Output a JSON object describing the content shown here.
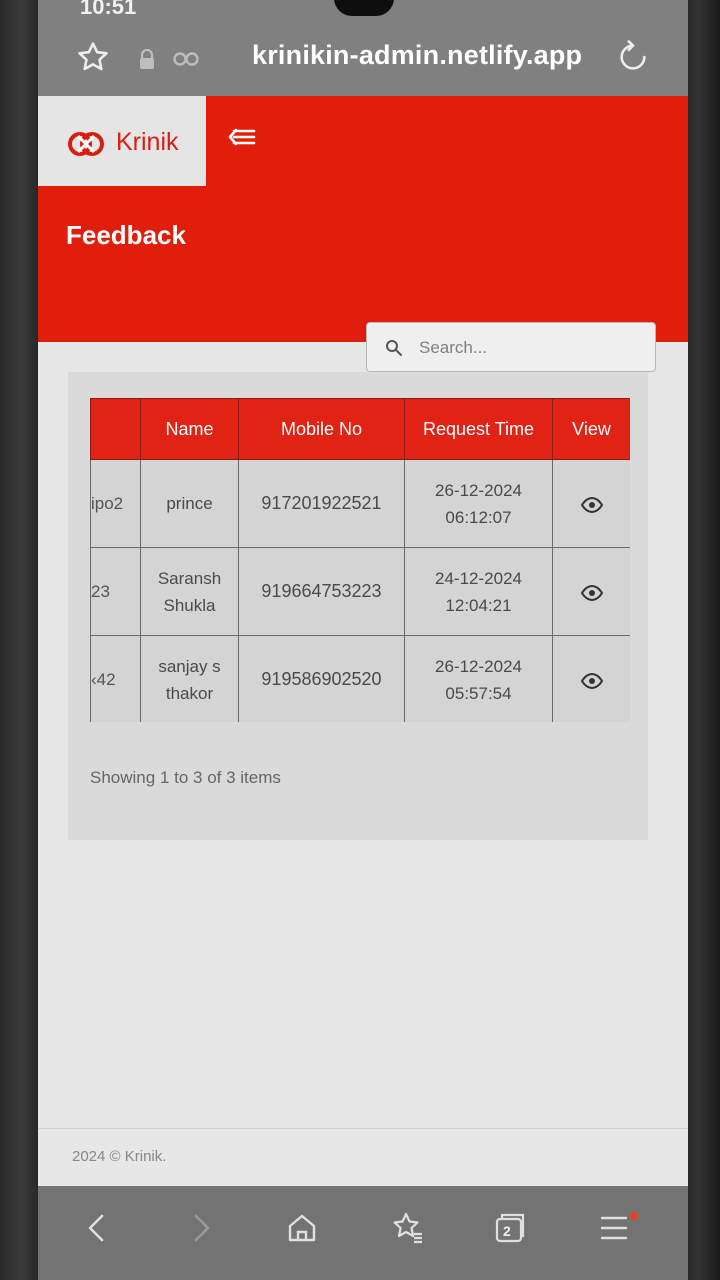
{
  "status_bar": {
    "time": "10:51"
  },
  "browser": {
    "url": "krinikin-admin.netlify.app",
    "icons": [
      "star-icon",
      "lock-icon",
      "tracker-icon",
      "reload-icon"
    ]
  },
  "brand": {
    "name": "Krinik",
    "color": "#e01e0b"
  },
  "page": {
    "title": "Feedback"
  },
  "search": {
    "placeholder": "Search..."
  },
  "table": {
    "columns": [
      "",
      "Name",
      "Mobile No",
      "Request Time",
      "View"
    ],
    "rows": [
      {
        "id": "ipo2",
        "name_line1": "prince",
        "name_line2": "",
        "mobile": "917201922521",
        "date": "26-12-2024",
        "time": "06:12:07"
      },
      {
        "id": "23",
        "name_line1": "Saransh",
        "name_line2": "Shukla",
        "mobile": "919664753223",
        "date": "24-12-2024",
        "time": "12:04:21"
      },
      {
        "id": "‹42",
        "name_line1": "sanjay s",
        "name_line2": "thakor",
        "mobile": "919586902520",
        "date": "26-12-2024",
        "time": "05:57:54"
      }
    ]
  },
  "pagination": {
    "summary": "Showing 1 to 3 of 3 items"
  },
  "footer": {
    "text": "2024 © Krinik."
  },
  "bottom_nav": {
    "tabs_count": "2",
    "icons": [
      "back-icon",
      "forward-icon",
      "home-icon",
      "bookmarks-icon",
      "tabs-icon",
      "menu-icon"
    ]
  }
}
